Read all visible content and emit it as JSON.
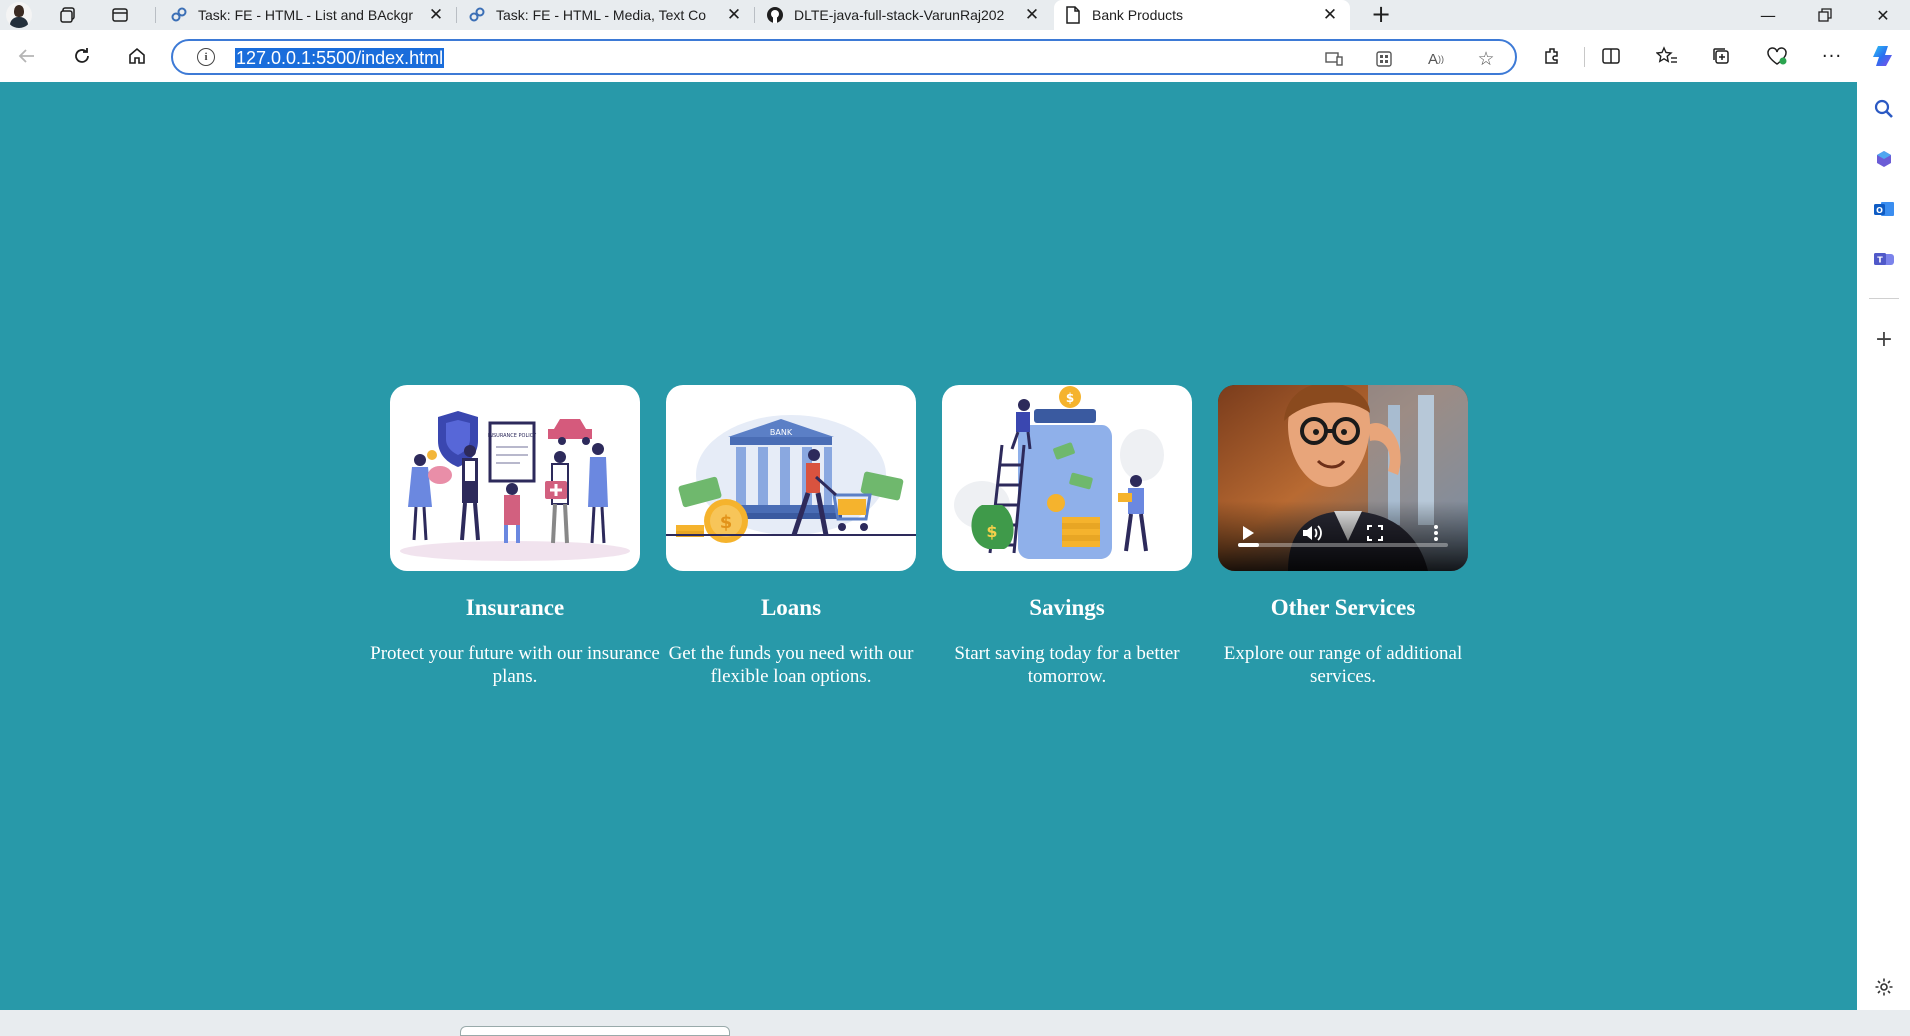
{
  "browser": {
    "tabs": [
      {
        "title": "Task: FE - HTML - List and BAckgr",
        "icon": "task-link-icon",
        "active": false
      },
      {
        "title": "Task: FE - HTML - Media, Text Co",
        "icon": "task-link-icon",
        "active": false
      },
      {
        "title": "DLTE-java-full-stack-VarunRaj202",
        "icon": "github-icon",
        "active": false
      },
      {
        "title": "Bank Products",
        "icon": "page-icon",
        "active": true
      }
    ],
    "address": {
      "url": "127.0.0.1:5500/index.html"
    }
  },
  "page": {
    "background": "#2899a9",
    "cards": [
      {
        "title": "Insurance",
        "description": "Protect your future with our insurance plans.",
        "media": "insurance-illustration",
        "badge_text": "INSURANCE POLICY"
      },
      {
        "title": "Loans",
        "description": "Get the funds you need with our flexible loan options.",
        "media": "loans-illustration",
        "badge_text": "BANK"
      },
      {
        "title": "Savings",
        "description": "Start saving today for a better tomorrow.",
        "media": "savings-illustration"
      },
      {
        "title": "Other Services",
        "description": "Explore our range of additional services.",
        "media": "video-player",
        "video_progress": 0.1
      }
    ]
  },
  "colors": {
    "accent": "#1a6ddb",
    "page_bg": "#2899a9",
    "card_bg": "#ffffff"
  }
}
